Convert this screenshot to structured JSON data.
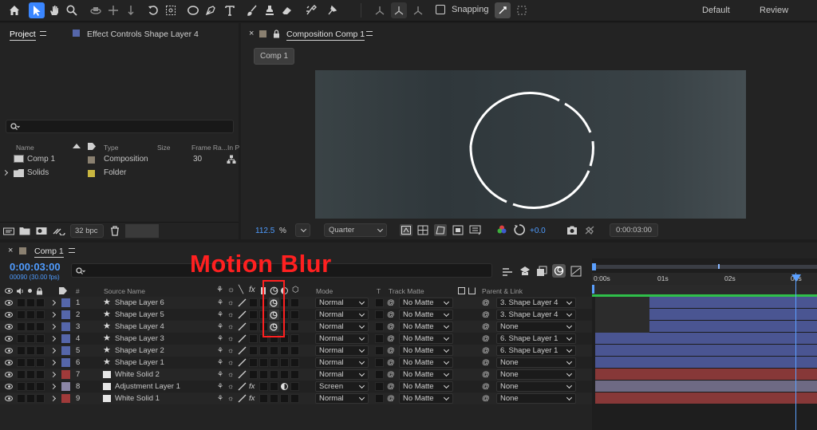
{
  "toolbar": {
    "snapping_label": "Snapping",
    "workspaces": [
      "Default",
      "Review"
    ],
    "colors": {
      "active_tool": "#3a86ff"
    }
  },
  "project_panel": {
    "tab_label": "Project",
    "effect_controls_label": "Effect Controls Shape Layer 4",
    "search_placeholder": "",
    "columns": {
      "name": "Name",
      "type": "Type",
      "size": "Size",
      "frame_rate": "Frame Ra...",
      "in_point": "In P"
    },
    "items": [
      {
        "name": "Comp 1",
        "type": "Composition",
        "size": "",
        "frame_rate": "30",
        "color": "#8a8070"
      },
      {
        "name": "Solids",
        "type": "Folder",
        "size": "",
        "frame_rate": "",
        "color": "#c9b640"
      }
    ],
    "bpc_label": "32 bpc"
  },
  "comp_panel": {
    "tab_label": "Composition Comp 1",
    "comp_button": "Comp 1",
    "zoom_value": "112.5",
    "zoom_unit": "%",
    "resolution": "Quarter",
    "exposure": "+0.0",
    "timecode": "0:00:03:00"
  },
  "timeline": {
    "tab_label": "Comp 1",
    "timecode": "0:00:03:00",
    "frame_info": "00090 (30.00 fps)",
    "search_placeholder": "",
    "annotation": "Motion Blur",
    "annotation_color": "#ff2020",
    "columns": {
      "num": "#",
      "source": "Source Name",
      "mode": "Mode",
      "t": "T",
      "track_matte": "Track Matte",
      "parent": "Parent & Link"
    },
    "ruler": [
      "0:00s",
      "01s",
      "02s",
      "03s"
    ],
    "layers": [
      {
        "num": "1",
        "name": "Shape Layer 6",
        "label": "#5566aa",
        "shape": true,
        "mode": "Normal",
        "matte": "No Matte",
        "parent": "3. Shape Layer 4",
        "motion_blur": true,
        "fx": false,
        "adj": false
      },
      {
        "num": "2",
        "name": "Shape Layer 5",
        "label": "#5566aa",
        "shape": true,
        "mode": "Normal",
        "matte": "No Matte",
        "parent": "3. Shape Layer 4",
        "motion_blur": true,
        "fx": false,
        "adj": false
      },
      {
        "num": "3",
        "name": "Shape Layer 4",
        "label": "#5566aa",
        "shape": true,
        "mode": "Normal",
        "matte": "No Matte",
        "parent": "None",
        "motion_blur": true,
        "fx": false,
        "adj": false
      },
      {
        "num": "4",
        "name": "Shape Layer 3",
        "label": "#5566aa",
        "shape": true,
        "mode": "Normal",
        "matte": "No Matte",
        "parent": "6. Shape Layer 1",
        "motion_blur": false,
        "fx": false,
        "adj": false
      },
      {
        "num": "5",
        "name": "Shape Layer 2",
        "label": "#5566aa",
        "shape": true,
        "mode": "Normal",
        "matte": "No Matte",
        "parent": "6. Shape Layer 1",
        "motion_blur": false,
        "fx": false,
        "adj": false
      },
      {
        "num": "6",
        "name": "Shape Layer 1",
        "label": "#5566aa",
        "shape": true,
        "mode": "Normal",
        "matte": "No Matte",
        "parent": "None",
        "motion_blur": false,
        "fx": false,
        "adj": false
      },
      {
        "num": "7",
        "name": "White Solid 2",
        "label": "#a03a3a",
        "shape": false,
        "mode": "Normal",
        "matte": "No Matte",
        "parent": "None",
        "motion_blur": false,
        "fx": false,
        "adj": false
      },
      {
        "num": "8",
        "name": "Adjustment Layer 1",
        "label": "#8c86a6",
        "shape": false,
        "mode": "Screen",
        "matte": "No Matte",
        "parent": "None",
        "motion_blur": false,
        "fx": true,
        "adj": true
      },
      {
        "num": "9",
        "name": "White Solid 1",
        "label": "#a03a3a",
        "shape": false,
        "mode": "Normal",
        "matte": "No Matte",
        "parent": "None",
        "motion_blur": false,
        "fx": true,
        "adj": false
      }
    ]
  }
}
